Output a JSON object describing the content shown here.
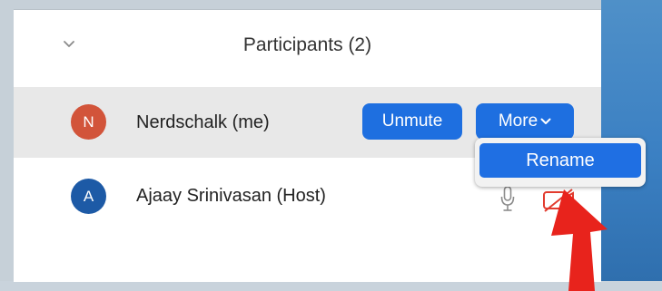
{
  "panel": {
    "title": "Participants (2)"
  },
  "participants": [
    {
      "initial": "N",
      "name": "Nerdschalk (me)",
      "avatar_color": "#d2543a",
      "highlighted": true,
      "actions": {
        "unmute_label": "Unmute",
        "more_label": "More"
      }
    },
    {
      "initial": "A",
      "name": "Ajaay Srinivasan (Host)",
      "avatar_color": "#1d5aa6",
      "highlighted": false,
      "status_icons": [
        "microphone-icon",
        "video-off-icon"
      ]
    }
  ],
  "more_menu": {
    "items": [
      {
        "label": "Rename",
        "selected": true
      }
    ]
  },
  "colors": {
    "accent_blue": "#1e6fe0",
    "annotation_arrow": "#e8231c",
    "row_highlight": "#e8e8e8"
  },
  "annotation": {
    "type": "arrow",
    "icon": "red-arrow-icon",
    "points_to": "Rename"
  }
}
